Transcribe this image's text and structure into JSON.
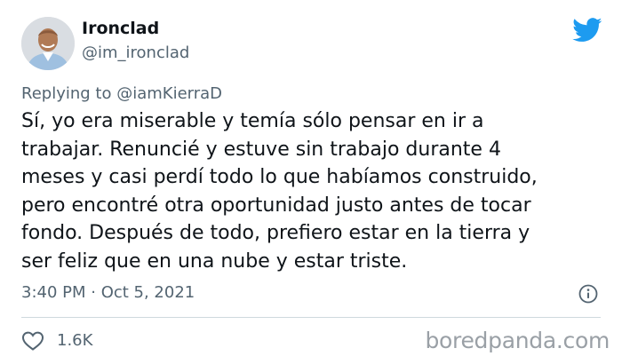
{
  "author": {
    "display_name": "Ironclad",
    "handle": "@im_ironclad"
  },
  "reply": {
    "prefix": "Replying to ",
    "mention": "@iamKierraD"
  },
  "tweet": {
    "lines": [
      "Sí, yo era miserable y temía sólo pensar en ir a",
      "trabajar. Renuncié y estuve sin trabajo durante 4",
      "meses y casi perdí todo lo que habíamos construido,",
      "pero encontré otra oportunidad justo antes de tocar",
      "fondo. Después de todo, prefiero estar en la tierra y",
      "ser feliz que en una nube y estar triste."
    ]
  },
  "meta": {
    "timestamp": "3:40 PM · Oct 5, 2021"
  },
  "engagement": {
    "likes": "1.6K"
  },
  "icons": {
    "brand": "twitter-bird-icon",
    "info": "info-icon",
    "like": "heart-icon"
  },
  "colors": {
    "twitter_blue": "#1d9bf0",
    "text": "#0f1419",
    "secondary": "#536471",
    "divider": "#cfd9de",
    "watermark": "#9aa0a6"
  },
  "watermark": "boredpanda.com"
}
